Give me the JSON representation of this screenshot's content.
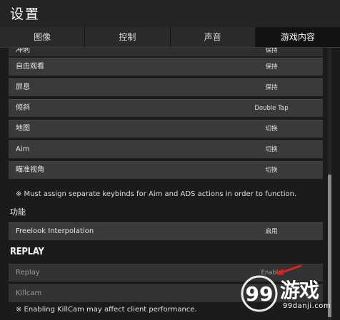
{
  "window": {
    "title": "设置"
  },
  "tabs": [
    {
      "label": "图像",
      "active": false
    },
    {
      "label": "控制",
      "active": false
    },
    {
      "label": "声音",
      "active": false
    },
    {
      "label": "游戏内容",
      "active": true
    }
  ],
  "keybinds": {
    "rows": [
      {
        "label": "冲刺",
        "value": "保持"
      },
      {
        "label": "自由观看",
        "value": "保持"
      },
      {
        "label": "屏息",
        "value": "保持"
      },
      {
        "label": "倾斜",
        "value": "Double Tap"
      },
      {
        "label": "地图",
        "value": "切换"
      },
      {
        "label": "Aim",
        "value": "切换"
      },
      {
        "label": "瞄准视角",
        "value": "切换"
      }
    ],
    "note": "※ Must assign separate keybinds for Aim and ADS actions in order to function."
  },
  "functions": {
    "heading": "功能",
    "rows": [
      {
        "label": "Freelook Interpolation",
        "value": "启用"
      }
    ]
  },
  "replay": {
    "heading": "REPLAY",
    "rows": [
      {
        "label": "Replay",
        "value": "Enable"
      },
      {
        "label": "Killcam",
        "value": ""
      }
    ],
    "note": "※ Enabling KillCam may affect client performance."
  },
  "watermark": {
    "brand": "游戏",
    "logo_digits": "99",
    "url": "99danji.com"
  },
  "colors": {
    "panel": "#3a3a3a",
    "background": "#1b1b1b",
    "arrow": "#e02020"
  }
}
